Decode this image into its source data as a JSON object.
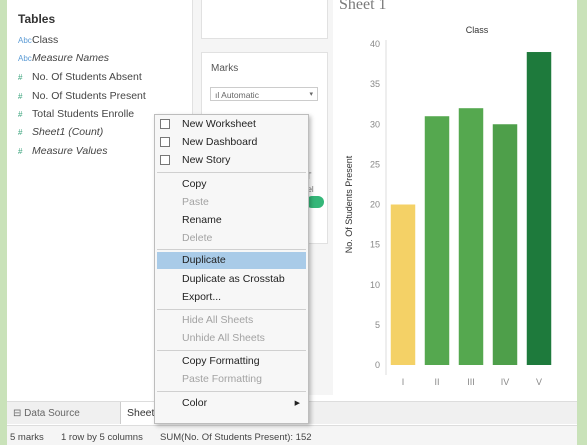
{
  "data_pane": {
    "title": "Tables",
    "fields": [
      {
        "label": "Class",
        "icon": "abc-icon",
        "italic": false
      },
      {
        "label": "Measure Names",
        "icon": "abc-icon",
        "italic": true
      },
      {
        "label": "No. Of Students Absent",
        "icon": "hash-icon",
        "italic": false
      },
      {
        "label": "No. Of Students Present",
        "icon": "hash-icon",
        "italic": false
      },
      {
        "label": "Total Students Enrolle",
        "icon": "hash-icon",
        "italic": false
      },
      {
        "label": "Sheet1 (Count)",
        "icon": "hash-icon",
        "italic": true
      },
      {
        "label": "Measure Values",
        "icon": "hash-icon",
        "italic": true
      }
    ]
  },
  "marks": {
    "title": "Marks",
    "type": "Automatic",
    "frag1": "T",
    "frag2": "bel"
  },
  "view": {
    "sheet_title": "Sheet 1"
  },
  "chart_data": {
    "type": "bar",
    "title": "Class",
    "xlabel": "",
    "ylabel": "No. Of Students Present",
    "categories": [
      "I",
      "II",
      "III",
      "IV",
      "V"
    ],
    "values": [
      20,
      31,
      32,
      30,
      39
    ],
    "ylim": [
      0,
      40
    ],
    "yticks": [
      0,
      5,
      10,
      15,
      20,
      25,
      30,
      35,
      40
    ],
    "colors": [
      "#f4d166",
      "#55a84f",
      "#55a84f",
      "#4e9f4a",
      "#1e7a3c"
    ],
    "grid": false
  },
  "context_menu": {
    "items": [
      {
        "label": "New Worksheet",
        "icon": "new-worksheet-icon",
        "enabled": true
      },
      {
        "label": "New Dashboard",
        "icon": "new-dashboard-icon",
        "enabled": true
      },
      {
        "label": "New Story",
        "icon": "new-story-icon",
        "enabled": true
      },
      {
        "label": "Copy",
        "enabled": true
      },
      {
        "label": "Paste",
        "enabled": false
      },
      {
        "label": "Rename",
        "enabled": true
      },
      {
        "label": "Delete",
        "enabled": false
      },
      {
        "label": "Duplicate",
        "enabled": true,
        "highlighted": true
      },
      {
        "label": "Duplicate as Crosstab",
        "enabled": true
      },
      {
        "label": "Export...",
        "enabled": true
      },
      {
        "label": "Hide All Sheets",
        "enabled": false
      },
      {
        "label": "Unhide All Sheets",
        "enabled": false
      },
      {
        "label": "Copy Formatting",
        "enabled": true
      },
      {
        "label": "Paste Formatting",
        "enabled": false
      },
      {
        "label": "Color",
        "enabled": true,
        "submenu": true
      }
    ]
  },
  "tabs": {
    "data_source": "Data Source",
    "sheet": "Sheet 1"
  },
  "status": {
    "marks": "5 marks",
    "dims": "1 row by 5 columns",
    "sum": "SUM(No. Of Students Present): 152"
  }
}
